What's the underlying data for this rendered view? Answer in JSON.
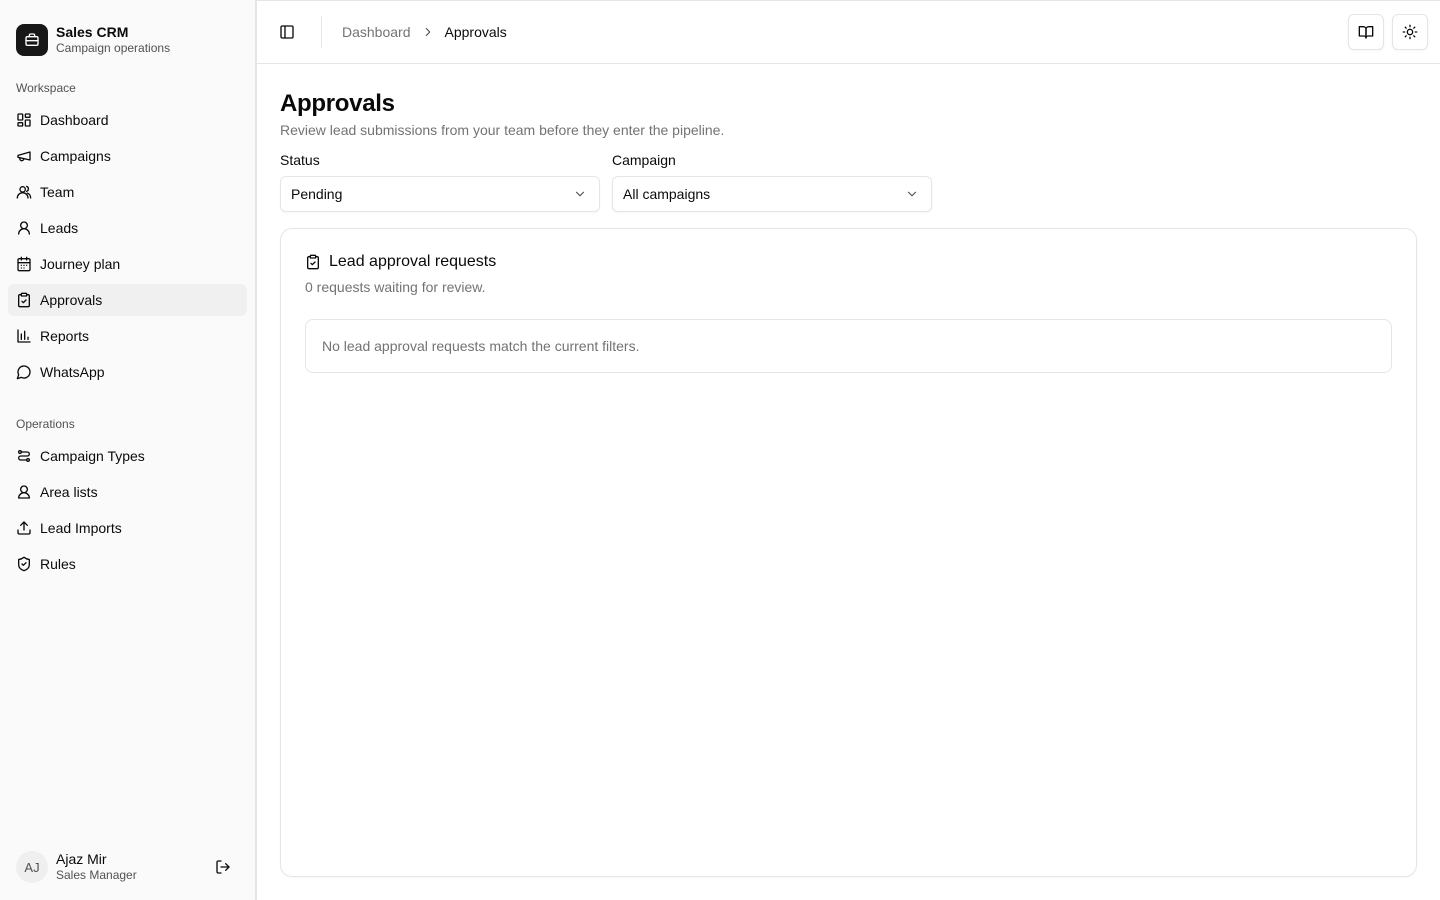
{
  "brand": {
    "title": "Sales CRM",
    "subtitle": "Campaign operations",
    "icon": "briefcase-icon"
  },
  "sidebar": {
    "workspace_label": "Workspace",
    "workspace_items": [
      {
        "label": "Dashboard",
        "icon": "layout-grid-icon"
      },
      {
        "label": "Campaigns",
        "icon": "megaphone-icon"
      },
      {
        "label": "Team",
        "icon": "users-icon"
      },
      {
        "label": "Leads",
        "icon": "user-icon"
      },
      {
        "label": "Journey plan",
        "icon": "calendar-icon"
      },
      {
        "label": "Approvals",
        "icon": "clipboard-check-icon",
        "active": true
      },
      {
        "label": "Reports",
        "icon": "bar-chart-icon"
      },
      {
        "label": "WhatsApp",
        "icon": "message-circle-icon"
      }
    ],
    "operations_label": "Operations",
    "operations_items": [
      {
        "label": "Campaign Types",
        "icon": "route-icon"
      },
      {
        "label": "Area lists",
        "icon": "user-pin-icon"
      },
      {
        "label": "Lead Imports",
        "icon": "upload-icon"
      },
      {
        "label": "Rules",
        "icon": "shield-check-icon"
      }
    ]
  },
  "user": {
    "initials": "AJ",
    "name": "Ajaz Mir",
    "role": "Sales Manager"
  },
  "header": {
    "breadcrumb": {
      "parent": "Dashboard",
      "current": "Approvals"
    }
  },
  "page": {
    "title": "Approvals",
    "description": "Review lead submissions from your team before they enter the pipeline."
  },
  "filters": {
    "status_label": "Status",
    "status_value": "Pending",
    "campaign_label": "Campaign",
    "campaign_value": "All campaigns"
  },
  "card": {
    "title": "Lead approval requests",
    "description": "0 requests waiting for review.",
    "empty_message": "No lead approval requests match the current filters."
  }
}
